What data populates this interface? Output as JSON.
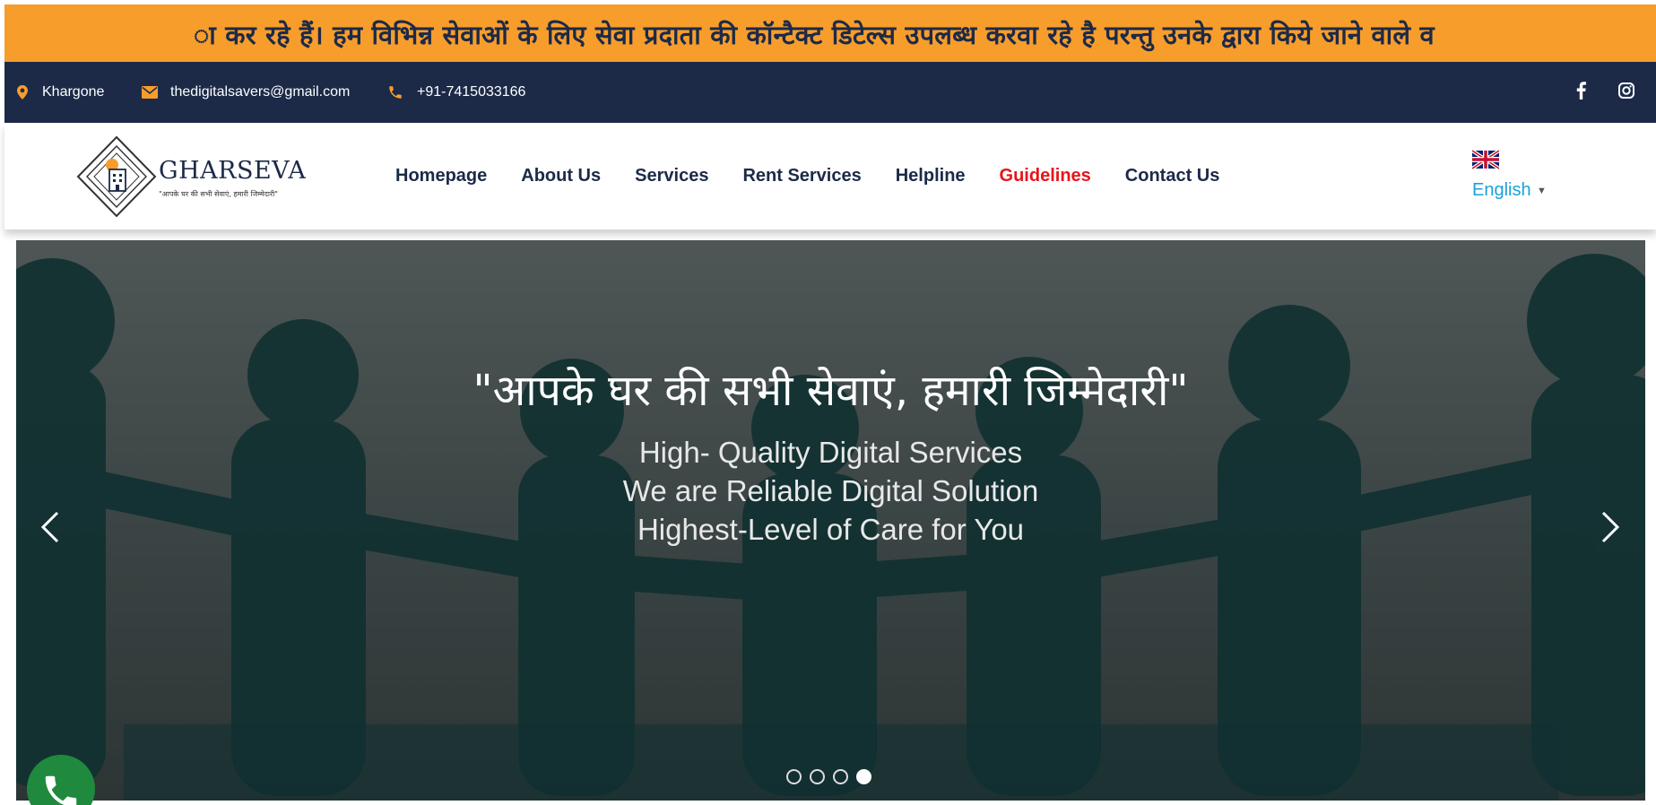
{
  "ticker": {
    "text": "ा कर रहे हैं। हम विभिन्न सेवाओं के लिए सेवा प्रदाता की कॉन्टैक्ट डिटेल्स उपलब्ध करवा रहे है परन्तु उनके द्वारा किये जाने वाले व"
  },
  "topbar": {
    "location": "Khargone",
    "email": "thedigitalsavers@gmail.com",
    "phone": "+91-7415033166",
    "icons": {
      "location": "map-pin-icon",
      "email": "envelope-icon",
      "phone": "phone-icon",
      "facebook": "facebook-icon",
      "instagram": "instagram-icon"
    }
  },
  "logo": {
    "title": "GHARSEVA",
    "tagline": "\"आपके घर की सभी सेवाएं, हमारी जिम्मेदारी\""
  },
  "nav": {
    "items": [
      {
        "label": "Homepage"
      },
      {
        "label": "About Us"
      },
      {
        "label": "Services"
      },
      {
        "label": "Rent Services"
      },
      {
        "label": "Helpline"
      },
      {
        "label": "Guidelines"
      },
      {
        "label": "Contact Us"
      }
    ],
    "active_index": 5
  },
  "language": {
    "selected": "English",
    "flag": "uk-flag-icon"
  },
  "hero": {
    "title": "\"आपके घर की सभी सेवाएं, हमारी जिम्मेदारी\"",
    "lines": [
      "High- Quality Digital Services",
      "We are Reliable Digital Solution",
      "Highest-Level of Care for You"
    ],
    "slide_count": 4,
    "active_slide": 4
  },
  "colors": {
    "ticker_bg": "#f79d2c",
    "navy": "#1c2a48",
    "accent_red": "#e5151b",
    "lang_blue": "#1aa3d9",
    "call_green": "#1f8a3d"
  }
}
